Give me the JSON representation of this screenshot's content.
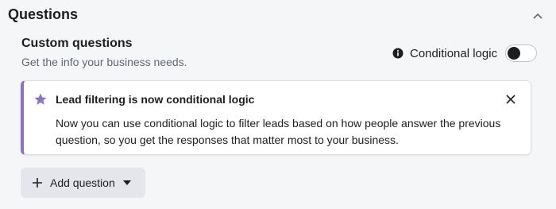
{
  "section": {
    "title": "Questions"
  },
  "custom_questions": {
    "heading": "Custom questions",
    "subtext": "Get the info your business needs."
  },
  "conditional_logic": {
    "label": "Conditional logic",
    "enabled": false
  },
  "notice": {
    "title": "Lead filtering is now conditional logic",
    "body": "Now you can use conditional logic to filter leads based on how people answer the previous question, so you get the responses that matter most to your business.",
    "accent_color": "#8c72cb"
  },
  "add_question": {
    "label": "Add question"
  },
  "icons": {
    "collapse": "chevron-up-icon",
    "info": "info-icon",
    "star": "star-icon",
    "close": "close-icon",
    "plus": "plus-icon",
    "caret": "caret-down-icon"
  }
}
